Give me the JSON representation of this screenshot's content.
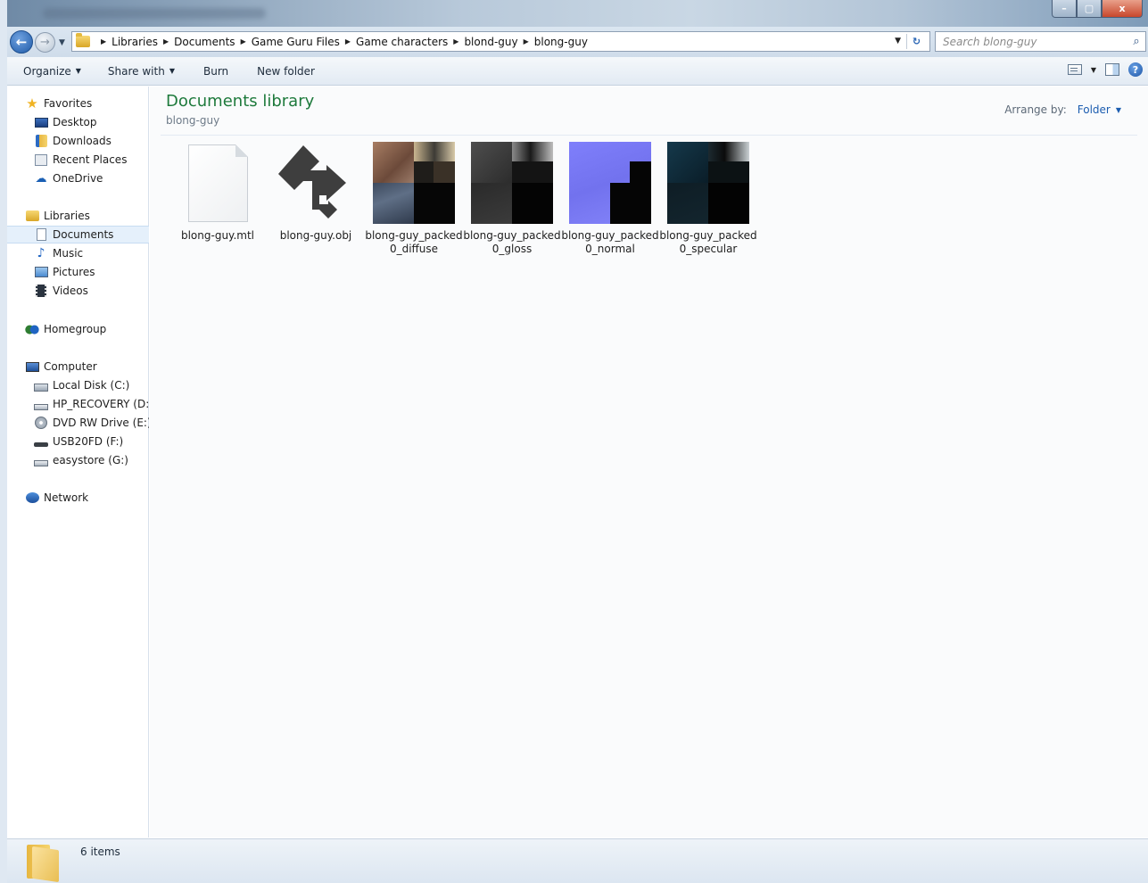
{
  "window": {
    "controls": {
      "minimize": "–",
      "maximize": "▢",
      "close": "x"
    }
  },
  "nav": {
    "back_glyph": "←",
    "forward_glyph": "→",
    "breadcrumbs": [
      "Libraries",
      "Documents",
      "Game Guru Files",
      "Game characters",
      "blond-guy",
      "blong-guy"
    ],
    "search_placeholder": "Search blong-guy"
  },
  "toolbar": {
    "organize": "Organize",
    "share_with": "Share with",
    "burn": "Burn",
    "new_folder": "New folder",
    "help": "?"
  },
  "sidebar": {
    "favorites": "Favorites",
    "desktop": "Desktop",
    "downloads": "Downloads",
    "recent_places": "Recent Places",
    "onedrive": "OneDrive",
    "libraries": "Libraries",
    "documents": "Documents",
    "music": "Music",
    "pictures": "Pictures",
    "videos": "Videos",
    "homegroup": "Homegroup",
    "computer": "Computer",
    "local_disk": "Local Disk (C:)",
    "hp_recovery": "HP_RECOVERY (D:)",
    "dvd_drive": "DVD RW Drive (E:) M",
    "usb": "USB20FD (F:)",
    "easystore": "easystore (G:)",
    "network": "Network"
  },
  "content": {
    "library_title": "Documents library",
    "library_subtitle": "blong-guy",
    "arrange_label": "Arrange by:",
    "arrange_value": "Folder",
    "files": [
      {
        "name": "blong-guy.mtl",
        "type": "document"
      },
      {
        "name": "blong-guy.obj",
        "type": "object"
      },
      {
        "name": "blong-guy_packed0_diffuse",
        "type": "texture",
        "tint": "#8a6a55"
      },
      {
        "name": "blong-guy_packed0_gloss",
        "type": "texture",
        "tint": "#3a3a3a"
      },
      {
        "name": "blong-guy_packed0_normal",
        "type": "texture",
        "tint": "#7b7bf6"
      },
      {
        "name": "blong-guy_packed0_specular",
        "type": "texture",
        "tint": "#0d2230"
      }
    ]
  },
  "status": {
    "items_count": "6 items"
  }
}
